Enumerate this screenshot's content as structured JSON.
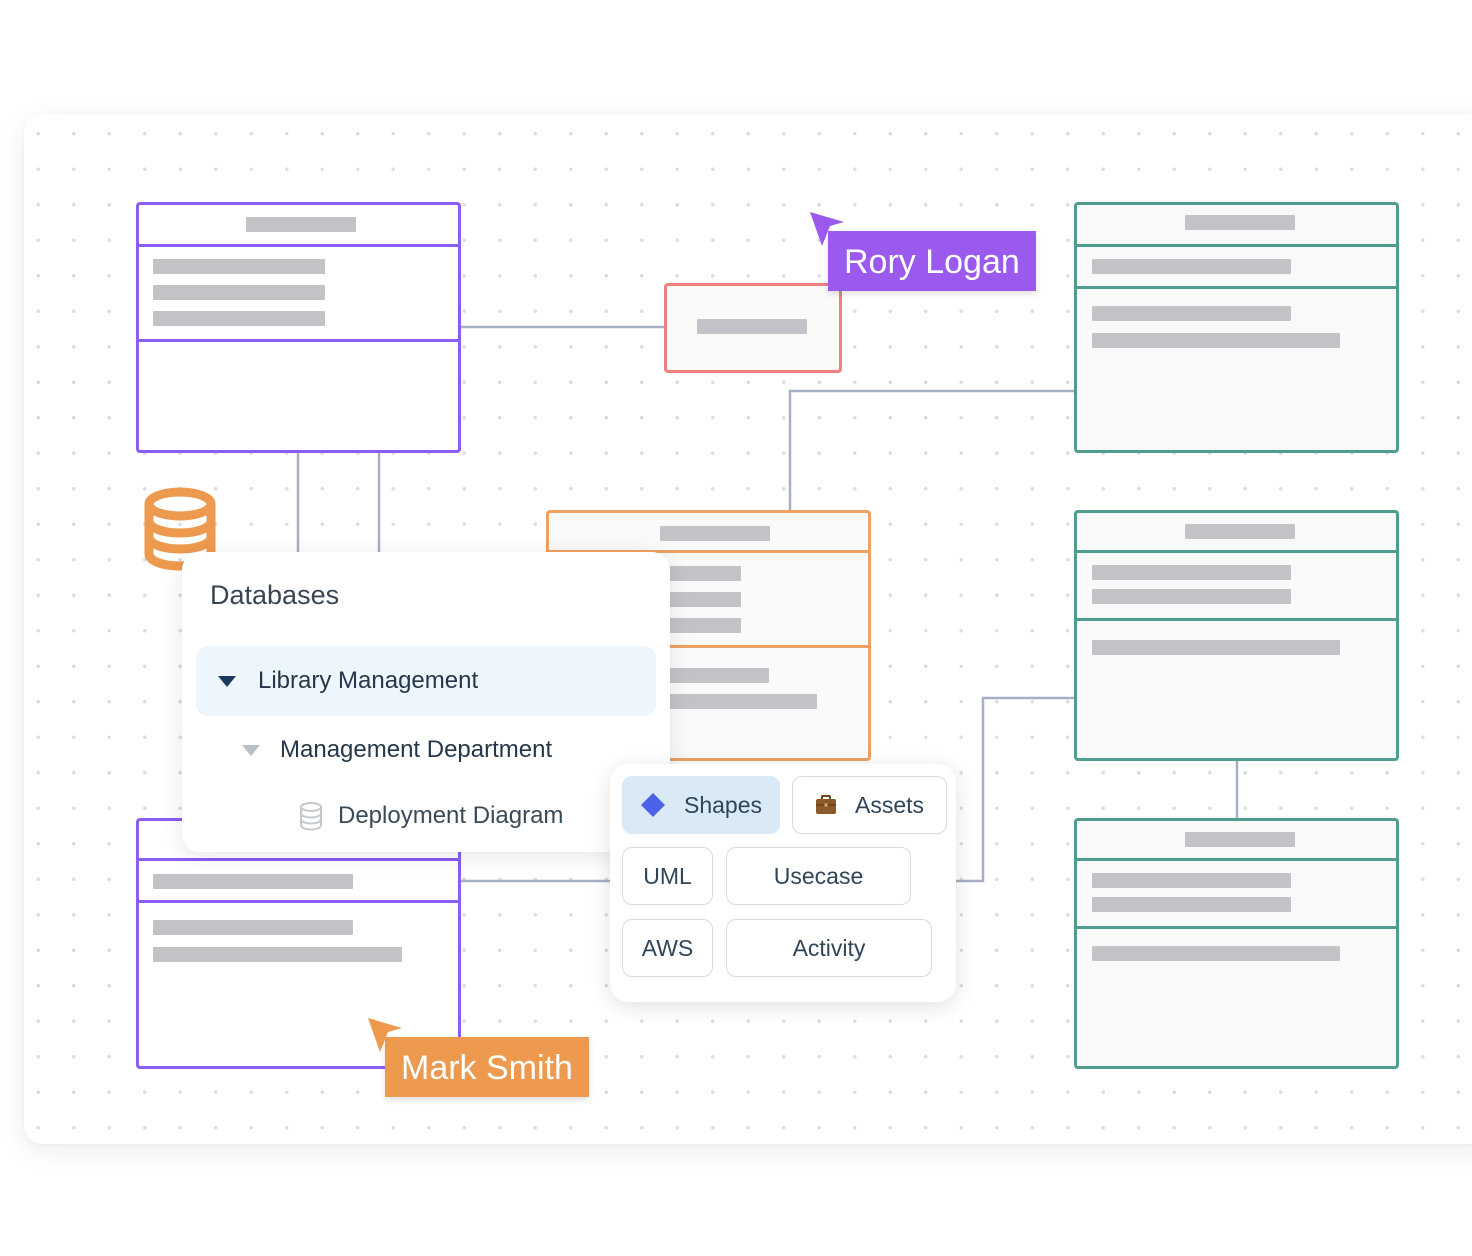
{
  "colors": {
    "purple": "#8b5cf6",
    "teal": "#4f9d8f",
    "orange": "#f0a060",
    "red": "#ee8080",
    "connector": "#a7afc4",
    "placeholder_bar": "#c2c3c6",
    "cursor_rory": "#9c59ee",
    "cursor_mark": "#ee9a4e"
  },
  "cursors": {
    "rory": {
      "name": "Rory Logan"
    },
    "mark": {
      "name": "Mark Smith"
    }
  },
  "database_tree": {
    "title": "Databases",
    "items": [
      {
        "label": "Library Management",
        "level": 0,
        "expanded": true,
        "selected": true,
        "icon": "caret-down-icon"
      },
      {
        "label": "Management Department",
        "level": 1,
        "expanded": true,
        "selected": false,
        "icon": "caret-down-icon"
      },
      {
        "label": "Deployment Diagram",
        "level": 2,
        "selected": false,
        "icon": "database-icon"
      }
    ]
  },
  "shapes_panel": {
    "tabs": [
      {
        "label": "Shapes",
        "icon": "diamond-icon",
        "active": true
      },
      {
        "label": "Assets",
        "icon": "briefcase-icon",
        "active": false
      }
    ],
    "categories": [
      "UML",
      "Usecase",
      "AWS",
      "Activity"
    ]
  }
}
